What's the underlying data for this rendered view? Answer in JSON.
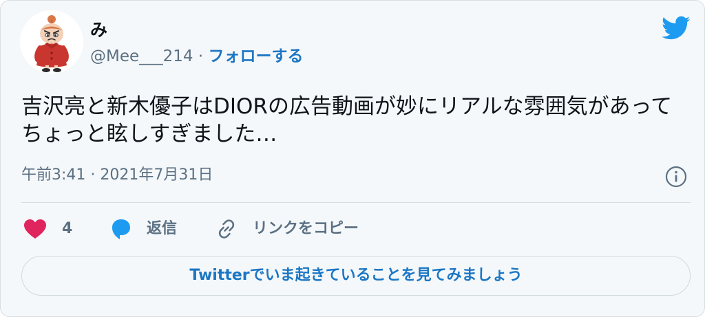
{
  "author": {
    "display_name": "み",
    "handle": "@Mee___214",
    "separator": " · ",
    "follow_label": "フォローする",
    "avatar_icon": "little-my-character-avatar"
  },
  "tweet": {
    "text": "吉沢亮と新木優子はDIORの広告動画が妙にリアルな雰囲気があってちょっと眩しすぎました…",
    "time": "午前3:41",
    "meta_separator": " · ",
    "date": "2021年7月31日"
  },
  "actions": {
    "like_count": "4",
    "reply_label": "返信",
    "copy_link_label": "リンクをコピー"
  },
  "cta": {
    "label": "Twitterでいま起きていることを見てみましょう"
  },
  "icons": {
    "brand": "twitter-bird-icon",
    "info": "info-icon",
    "like": "heart-icon",
    "reply": "speech-bubble-icon",
    "copy": "link-icon"
  },
  "colors": {
    "link_blue": "#1b76c4",
    "twitter_blue": "#1d9bf0",
    "like_pink": "#e0245e",
    "text_primary": "#0f1419",
    "text_secondary": "#5b7083",
    "card_background": "#f5f8fa"
  }
}
